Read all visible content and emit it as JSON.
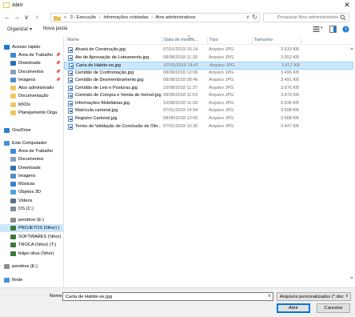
{
  "window": {
    "title": "Abrir",
    "close_glyph": "✕"
  },
  "address": {
    "nav_buttons": [
      "←",
      "→",
      "∨",
      "↑"
    ],
    "breadcrumb": [
      "«",
      "3 - Execução",
      "›",
      "Informações coletadas",
      "›",
      "Atos administrativos"
    ],
    "dropdown_glyph": "∨",
    "refresh_glyph": "↻"
  },
  "search": {
    "placeholder": "Pesquisar Atos administrativos"
  },
  "toolbar": {
    "organize_label": "Organizar ▾",
    "new_folder_label": "Nova pasta"
  },
  "nav": {
    "items": [
      {
        "label": "Acesso rápido",
        "icon": "star-icon",
        "color": "#1e78d6",
        "indent": 0,
        "pinned": false,
        "selected": false
      },
      {
        "label": "Área de Trabalho",
        "icon": "desktop-icon",
        "color": "#3d8ad8",
        "indent": 1,
        "pinned": true,
        "selected": false
      },
      {
        "label": "Downloads",
        "icon": "download-icon",
        "color": "#2f6fb5",
        "indent": 1,
        "pinned": true,
        "selected": false
      },
      {
        "label": "Documentos",
        "icon": "documents-icon",
        "color": "#8aa1b8",
        "indent": 1,
        "pinned": true,
        "selected": false
      },
      {
        "label": "Imagens",
        "icon": "pictures-icon",
        "color": "#4f8fc9",
        "indent": 1,
        "pinned": true,
        "selected": false
      },
      {
        "label": "Atos administrativ",
        "icon": "folder-icon",
        "color": "#f0c75e",
        "indent": 1,
        "pinned": false,
        "selected": false
      },
      {
        "label": "Documentação",
        "icon": "folder-icon",
        "color": "#f0c75e",
        "indent": 1,
        "pinned": false,
        "selected": false
      },
      {
        "label": "MXDs",
        "icon": "folder-icon",
        "color": "#f0c75e",
        "indent": 1,
        "pinned": false,
        "selected": false
      },
      {
        "label": "Planejamento Orga",
        "icon": "folder-icon",
        "color": "#f0c75e",
        "indent": 1,
        "pinned": false,
        "selected": false
      },
      {
        "label": "OneDrive",
        "icon": "cloud-icon",
        "color": "#2b7cd3",
        "indent": 0,
        "pinned": false,
        "selected": false
      },
      {
        "label": "Este Computador",
        "icon": "computer-icon",
        "color": "#4a90d9",
        "indent": 0,
        "pinned": false,
        "selected": false
      },
      {
        "label": "Área de Trabalho",
        "icon": "desktop-icon",
        "color": "#3d8ad8",
        "indent": 1,
        "pinned": false,
        "selected": false
      },
      {
        "label": "Documentos",
        "icon": "documents-icon",
        "color": "#8aa1b8",
        "indent": 1,
        "pinned": false,
        "selected": false
      },
      {
        "label": "Downloads",
        "icon": "download-icon",
        "color": "#2f6fb5",
        "indent": 1,
        "pinned": false,
        "selected": false
      },
      {
        "label": "Imagens",
        "icon": "pictures-icon",
        "color": "#4f8fc9",
        "indent": 1,
        "pinned": false,
        "selected": false
      },
      {
        "label": "Músicas",
        "icon": "music-icon",
        "color": "#3b7bd0",
        "indent": 1,
        "pinned": false,
        "selected": false
      },
      {
        "label": "Objetos 3D",
        "icon": "objects3d-icon",
        "color": "#4aa3df",
        "indent": 1,
        "pinned": false,
        "selected": false
      },
      {
        "label": "Vídeos",
        "icon": "videos-icon",
        "color": "#5a6f8c",
        "indent": 1,
        "pinned": false,
        "selected": false
      },
      {
        "label": "OS (C:)",
        "icon": "drive-icon",
        "color": "#7d8c9a",
        "indent": 1,
        "pinned": false,
        "selected": false
      },
      {
        "label": "pendrive (E:)",
        "icon": "usb-drive-icon",
        "color": "#8c8c8c",
        "indent": 1,
        "pinned": false,
        "selected": false
      },
      {
        "label": "PROJETOS (\\\\thor) (",
        "icon": "network-drive-icon",
        "color": "#3c7a3c",
        "indent": 1,
        "pinned": false,
        "selected": true
      },
      {
        "label": "SOFTWARES (\\\\thor)",
        "icon": "network-drive-icon",
        "color": "#3c7a3c",
        "indent": 1,
        "pinned": false,
        "selected": false
      },
      {
        "label": "TROCA (\\\\thor) (T:)",
        "icon": "network-drive-icon",
        "color": "#3c7a3c",
        "indent": 1,
        "pinned": false,
        "selected": false
      },
      {
        "label": "felipe.oliva (\\\\thor)",
        "icon": "network-drive-icon",
        "color": "#3c7a3c",
        "indent": 1,
        "pinned": false,
        "selected": false
      },
      {
        "label": "pendrive (E:)",
        "icon": "usb-drive-icon",
        "color": "#8c8c8c",
        "indent": 0,
        "pinned": false,
        "selected": false
      },
      {
        "label": "Rede",
        "icon": "network-icon",
        "color": "#4a90d9",
        "indent": 0,
        "pinned": false,
        "selected": false
      }
    ]
  },
  "list": {
    "columns": [
      "Nome",
      "Data de modific...",
      "Tipo",
      "Tamanho"
    ],
    "collapse_glyph": "^",
    "rows": [
      {
        "name": "Alvará de Construção.jpg",
        "date": "07/01/2019 15:14",
        "type": "Arquivo JPG",
        "size": "3.633 KB",
        "selected": false
      },
      {
        "name": "Ato de Aprovação de Loteamento.jpg",
        "date": "08/08/2018 11:30",
        "type": "Arquivo JPG",
        "size": "3.552 KB",
        "selected": false
      },
      {
        "name": "Carta de Habite-se.jpg",
        "date": "07/01/2019 14:47",
        "type": "Arquivo JPG",
        "size": "3.617 KB",
        "selected": true
      },
      {
        "name": "Certidão de Confrontação.jpg",
        "date": "08/08/2018 12:06",
        "type": "Arquivo JPG",
        "size": "3.496 KB",
        "selected": false
      },
      {
        "name": "Certidão de Desmembramento.jpg",
        "date": "08/08/2018 08:46",
        "type": "Arquivo JPG",
        "size": "3.491 KB",
        "selected": false
      },
      {
        "name": "Certidão de Leis e Posturas.jpg",
        "date": "10/08/2018 11:37",
        "type": "Arquivo JPG",
        "size": "3.676 KB",
        "selected": false
      },
      {
        "name": "Contrato de Compra e Venda de Imóvel.jpg",
        "date": "08/08/2018 11:53",
        "type": "Arquivo JPG",
        "size": "3.470 KB",
        "selected": false
      },
      {
        "name": "Informações Mobiliárias.jpg",
        "date": "10/08/2018 11:33",
        "type": "Arquivo JPG",
        "size": "3.636 KB",
        "selected": false
      },
      {
        "name": "Matrícula cartorial.jpg",
        "date": "07/01/2019 14:54",
        "type": "Arquivo JPG",
        "size": "3.598 KB",
        "selected": false
      },
      {
        "name": "Registro Cartorial.jpg",
        "date": "08/08/2018 12:05",
        "type": "Arquivo JPG",
        "size": "3.588 KB",
        "selected": false
      },
      {
        "name": "Termo de Validação de Conclusão de Obr...",
        "date": "07/01/2019 15:30",
        "type": "Arquivo JPG",
        "size": "3.447 KB",
        "selected": false
      }
    ]
  },
  "bottom": {
    "filename_label": "Nome:",
    "filename_value": "Carta de Habite-se.jpg",
    "filetype_value": "Arquivos personalizados (*.doc",
    "open_label": "Abrir",
    "cancel_label": "Cancelar"
  },
  "colors": {
    "selection": "#cce8ff",
    "accent": "#0078d7"
  }
}
